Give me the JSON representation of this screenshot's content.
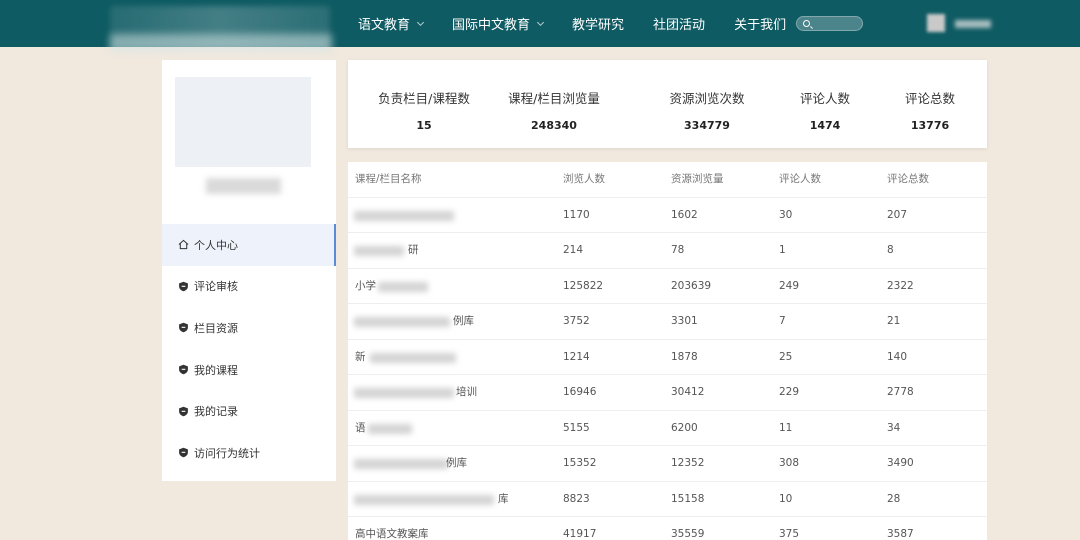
{
  "nav": {
    "items": [
      {
        "label": "语文教育",
        "dropdown": true
      },
      {
        "label": "国际中文教育",
        "dropdown": true
      },
      {
        "label": "教学研究",
        "dropdown": false
      },
      {
        "label": "社团活动",
        "dropdown": false
      },
      {
        "label": "关于我们",
        "dropdown": false
      }
    ]
  },
  "sidebar": {
    "items": [
      {
        "label": "个人中心",
        "icon": "home-icon",
        "active": true
      },
      {
        "label": "评论审核",
        "icon": "shield-icon",
        "active": false
      },
      {
        "label": "栏目资源",
        "icon": "shield-icon",
        "active": false
      },
      {
        "label": "我的课程",
        "icon": "shield-icon",
        "active": false
      },
      {
        "label": "我的记录",
        "icon": "shield-icon",
        "active": false
      },
      {
        "label": "访问行为统计",
        "icon": "shield-icon",
        "active": false
      }
    ]
  },
  "stats": [
    {
      "label": "负责栏目/课程数",
      "value": "15"
    },
    {
      "label": "课程/栏目浏览量",
      "value": "248340"
    },
    {
      "label": "资源浏览次数",
      "value": "334779"
    },
    {
      "label": "评论人数",
      "value": "1474"
    },
    {
      "label": "评论总数",
      "value": "13776"
    }
  ],
  "table": {
    "headers": [
      "课程/栏目名称",
      "浏览人数",
      "资源浏览量",
      "评论人数",
      "评论总数"
    ],
    "rows": [
      {
        "name_prefix": "",
        "name_suffix": "",
        "views": "1170",
        "resource_views": "1602",
        "commenters": "30",
        "comments": "207"
      },
      {
        "name_prefix": "",
        "name_suffix": "研",
        "views": "214",
        "resource_views": "78",
        "commenters": "1",
        "comments": "8"
      },
      {
        "name_prefix": "小学",
        "name_suffix": "",
        "views": "125822",
        "resource_views": "203639",
        "commenters": "249",
        "comments": "2322"
      },
      {
        "name_prefix": "",
        "name_suffix": "例库",
        "views": "3752",
        "resource_views": "3301",
        "commenters": "7",
        "comments": "21"
      },
      {
        "name_prefix": "新",
        "name_suffix": "",
        "views": "1214",
        "resource_views": "1878",
        "commenters": "25",
        "comments": "140"
      },
      {
        "name_prefix": "",
        "name_suffix": "培训",
        "views": "16946",
        "resource_views": "30412",
        "commenters": "229",
        "comments": "2778"
      },
      {
        "name_prefix": "语",
        "name_suffix": "",
        "views": "5155",
        "resource_views": "6200",
        "commenters": "11",
        "comments": "34"
      },
      {
        "name_prefix": "",
        "name_suffix": "例库",
        "views": "15352",
        "resource_views": "12352",
        "commenters": "308",
        "comments": "3490"
      },
      {
        "name_prefix": "",
        "name_suffix": "库",
        "views": "8823",
        "resource_views": "15158",
        "commenters": "10",
        "comments": "28"
      },
      {
        "name_prefix": "高中语文教案库",
        "name_suffix": "",
        "views": "41917",
        "resource_views": "35559",
        "commenters": "375",
        "comments": "3587"
      }
    ]
  },
  "colors": {
    "topbar": "#0f5b63",
    "page_bg": "#f1e9de",
    "active_menu_bg": "#eef3fb",
    "active_menu_border": "#5b8ad6"
  }
}
